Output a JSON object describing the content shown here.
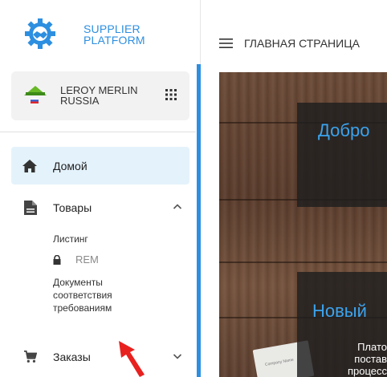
{
  "brand": {
    "line1": "SUPPLIER",
    "line2": "PLATFORM",
    "color": "#2d8fe0"
  },
  "org": {
    "line1": "LEROY MERLIN",
    "line2": "RUSSIA",
    "logo_text": "LEROY MERLIN"
  },
  "icons": {
    "apps": "apps-grid-icon",
    "home": "home-icon",
    "goods": "document-icon",
    "orders": "cart-icon",
    "menu": "hamburger-icon"
  },
  "nav": {
    "home": "Домой",
    "goods": "Товары",
    "goods_sub": {
      "listing": "Листинг",
      "rem": "REM",
      "docs": [
        "Документы",
        "соответствия",
        "требованиям"
      ]
    },
    "orders": "Заказы"
  },
  "header": {
    "title": "ГЛАВНАЯ СТРАНИЦА"
  },
  "hero": {
    "card1": "Добро",
    "card2": "Новый",
    "text3": [
      "Плато",
      "постав",
      "процесс"
    ],
    "paper_label": "Company Name",
    "accent": "#3ba3ee"
  }
}
